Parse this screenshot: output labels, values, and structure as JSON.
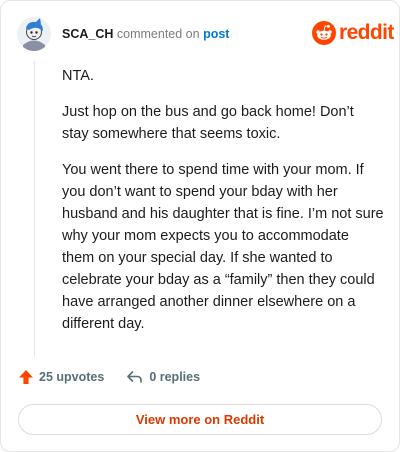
{
  "header": {
    "username": "SCA_CH",
    "action_text": "commented on",
    "post_link": "post",
    "brand_word": "reddit",
    "brand_color": "#ff4500"
  },
  "comment": {
    "paragraphs": [
      "NTA.",
      "Just hop on the bus and go back home! Don’t stay somewhere that seems toxic.",
      "You went there to spend time with your mom. If you don’t want to spend your bday with her husband and his daughter that is fine. I’m not sure why your mom expects you to accommodate them on your special day. If she wanted to celebrate your bday as a “family” then they could have arranged another dinner elsewhere on a different day."
    ]
  },
  "footer": {
    "upvotes": "25 upvotes",
    "replies": "0 replies",
    "upvote_icon": "upvote-arrow-icon",
    "reply_icon": "reply-arrow-icon",
    "accent_color": "#ff4500"
  },
  "cta": {
    "label": "View more on Reddit",
    "color": "#d93a00"
  }
}
